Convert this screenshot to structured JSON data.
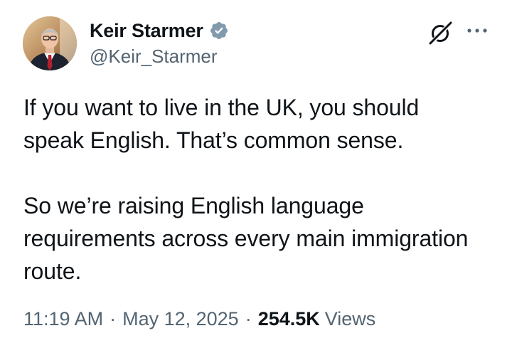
{
  "author": {
    "display_name": "Keir Starmer",
    "handle": "@Keir_Starmer",
    "verified": true
  },
  "icons": {
    "verified": "verified-badge-icon",
    "grok": "grok-icon",
    "more": "more-options-icon"
  },
  "tweet": {
    "text": "If you want to live in the UK, you should\nspeak English. That’s common sense.\n\nSo we’re raising English language\nrequirements across every main immigration\nroute."
  },
  "meta": {
    "time": "11:19 AM",
    "separator": "·",
    "date": "May 12, 2025",
    "views_count": "254.5K",
    "views_label": "Views"
  },
  "colors": {
    "text": "#0f1419",
    "secondary": "#536471",
    "verified_badge": "#829aab"
  }
}
